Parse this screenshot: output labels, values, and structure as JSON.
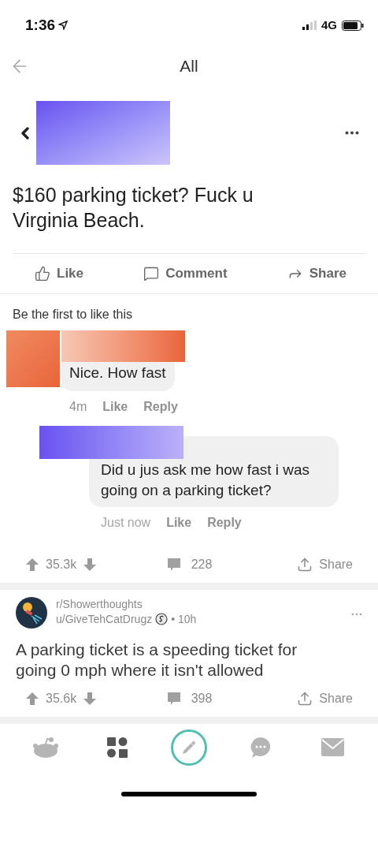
{
  "status_bar": {
    "time": "1:36",
    "network": "4G"
  },
  "header": {
    "title": "All"
  },
  "posts": [
    {
      "kind": "image",
      "screenshot": {
        "text": "$160 parking ticket? Fuck u Virginia Beach.",
        "actions": [
          {
            "kind": "like",
            "label": "Like"
          },
          {
            "kind": "comment",
            "label": "Comment"
          },
          {
            "kind": "share",
            "label": "Share"
          }
        ],
        "likes_note": "Be the first to like this",
        "comments": [
          {
            "kind": "comment",
            "text": "Nice. How fast",
            "time": "4m",
            "actions": [
              "Like",
              "Reply"
            ]
          },
          {
            "kind": "reply",
            "text": "Did u jus ask me how fast i was going on a parking ticket?",
            "time": "Just now",
            "actions": [
              "Like",
              "Reply"
            ]
          }
        ]
      },
      "votes": "35.3k",
      "comments": "228",
      "share": "Share"
    },
    {
      "kind": "text",
      "subreddit": "r/Showerthoughts",
      "user": "u/GiveTehCatDrugz",
      "meta": "• 10h",
      "title": "A parking ticket is a speeding ticket for going 0 mph where it isn't allowed",
      "votes": "35.6k",
      "comments": "398",
      "share": "Share"
    }
  ],
  "tab_bar": [
    {
      "kind": "home",
      "selected": false
    },
    {
      "kind": "communities",
      "selected": true
    },
    {
      "kind": "post",
      "selected": false
    },
    {
      "kind": "chat",
      "selected": false
    },
    {
      "kind": "inbox",
      "selected": false
    }
  ]
}
